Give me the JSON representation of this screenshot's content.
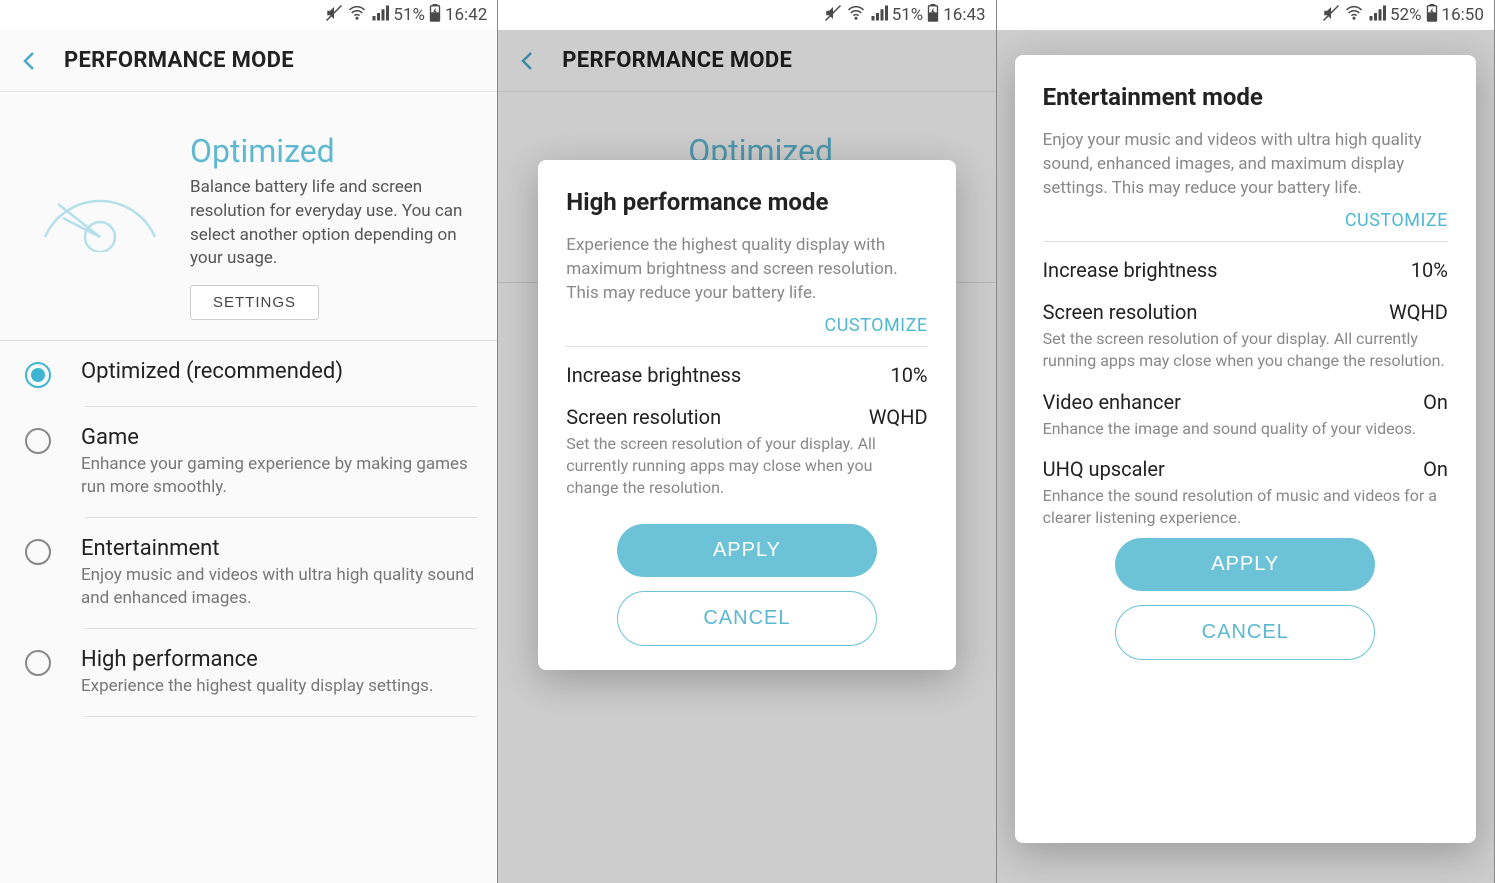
{
  "screen1": {
    "status": {
      "battery": "51%",
      "time": "16:42"
    },
    "header": {
      "title": "PERFORMANCE MODE"
    },
    "summary": {
      "title": "Optimized",
      "desc": "Balance battery life and screen resolution for everyday use. You can select another option depending on your usage.",
      "settings_btn": "SETTINGS"
    },
    "options": [
      {
        "title": "Optimized (recommended)",
        "desc": ""
      },
      {
        "title": "Game",
        "desc": "Enhance your gaming experience by making games run more smoothly."
      },
      {
        "title": "Entertainment",
        "desc": "Enjoy music and videos with ultra high quality sound and enhanced images."
      },
      {
        "title": "High performance",
        "desc": "Experience the highest quality display settings."
      }
    ]
  },
  "screen2": {
    "status": {
      "battery": "51%",
      "time": "16:43"
    },
    "header": {
      "title": "PERFORMANCE MODE"
    },
    "bg_title": "Optimized",
    "dialog": {
      "title": "High performance mode",
      "desc": "Experience the highest quality display with maximum brightness and screen resolution. This may reduce your battery life.",
      "customize": "CUSTOMIZE",
      "brightness_label": "Increase brightness",
      "brightness_value": "10%",
      "resolution_label": "Screen resolution",
      "resolution_value": "WQHD",
      "resolution_sub": "Set the screen resolution of your display. All currently running apps may close when you change the resolution.",
      "apply": "APPLY",
      "cancel": "CANCEL"
    }
  },
  "screen3": {
    "status": {
      "battery": "52%",
      "time": "16:50"
    },
    "dialog": {
      "title": "Entertainment mode",
      "desc": "Enjoy your music and videos with ultra high quality sound, enhanced images, and maximum display settings. This may reduce your battery life.",
      "customize": "CUSTOMIZE",
      "brightness_label": "Increase brightness",
      "brightness_value": "10%",
      "resolution_label": "Screen resolution",
      "resolution_value": "WQHD",
      "resolution_sub": "Set the screen resolution of your display. All currently running apps may close when you change the resolution.",
      "video_label": "Video enhancer",
      "video_value": "On",
      "video_sub": "Enhance the image and sound quality of your videos.",
      "uhq_label": "UHQ upscaler",
      "uhq_value": "On",
      "uhq_sub": "Enhance the sound resolution of music and videos for a clearer listening experience.",
      "apply": "APPLY",
      "cancel": "CANCEL"
    }
  }
}
